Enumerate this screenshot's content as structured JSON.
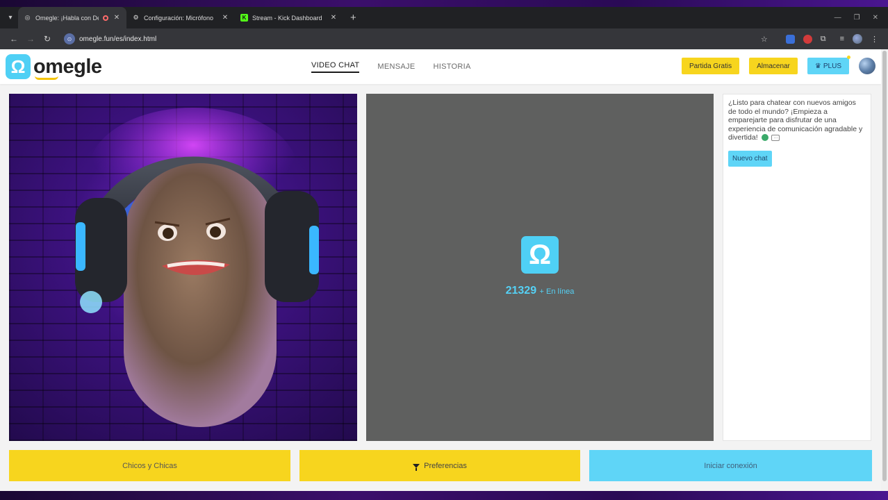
{
  "browser": {
    "tabs": [
      {
        "title": "Omegle: ¡Habla con Descor",
        "active": true
      },
      {
        "title": "Configuración: Micrófono",
        "active": false
      },
      {
        "title": "Stream - Kick Dashboard",
        "active": false
      }
    ],
    "url": "omegle.fun/es/index.html"
  },
  "header": {
    "logo_text": "omegle",
    "logo_glyph": "Ω",
    "nav": [
      "VIDEO CHAT",
      "MENSAJE",
      "HISTORIA"
    ],
    "buttons": {
      "free_game": "Partida Gratis",
      "store": "Almacenar",
      "plus": "PLUS"
    }
  },
  "status": {
    "online_count": "21329",
    "online_label": "+ En línea",
    "omega_glyph": "Ω"
  },
  "chat": {
    "intro": "¿Listo para chatear con nuevos amigos de todo el mundo? ¡Empieza a emparejarte para disfrutar de una experiencia de comunicación agradable y divertida!",
    "new_chat_label": "Nuevo chat"
  },
  "bottom_buttons": {
    "gender": "Chicos y Chicas",
    "preferences": "Preferencias",
    "start": "Iniciar conexión"
  },
  "colors": {
    "yellow": "#f7d51e",
    "cyan": "#5fd5f7",
    "video_bg": "#5f605f"
  }
}
